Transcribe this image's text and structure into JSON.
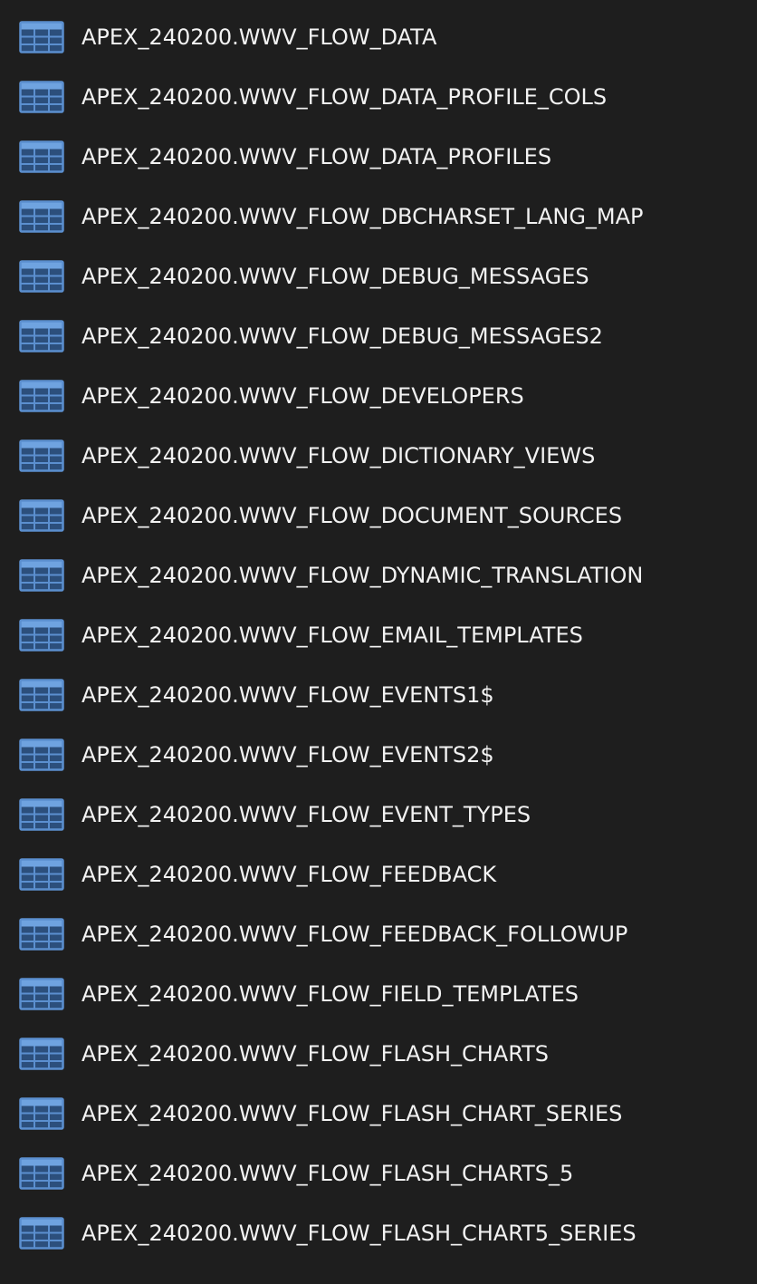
{
  "colors": {
    "background": "#1e1e1e",
    "text": "#f2f2f2",
    "icon_fill": "#2c4f7c",
    "icon_stroke": "#5b8fcf",
    "icon_header": "#6fa3e0"
  },
  "items": [
    {
      "label": "APEX_240200.WWV_FLOW_DATA",
      "icon": "table-icon"
    },
    {
      "label": "APEX_240200.WWV_FLOW_DATA_PROFILE_COLS",
      "icon": "table-icon"
    },
    {
      "label": "APEX_240200.WWV_FLOW_DATA_PROFILES",
      "icon": "table-icon"
    },
    {
      "label": "APEX_240200.WWV_FLOW_DBCHARSET_LANG_MAP",
      "icon": "table-icon"
    },
    {
      "label": "APEX_240200.WWV_FLOW_DEBUG_MESSAGES",
      "icon": "table-icon"
    },
    {
      "label": "APEX_240200.WWV_FLOW_DEBUG_MESSAGES2",
      "icon": "table-icon"
    },
    {
      "label": "APEX_240200.WWV_FLOW_DEVELOPERS",
      "icon": "table-icon"
    },
    {
      "label": "APEX_240200.WWV_FLOW_DICTIONARY_VIEWS",
      "icon": "table-icon"
    },
    {
      "label": "APEX_240200.WWV_FLOW_DOCUMENT_SOURCES",
      "icon": "table-icon"
    },
    {
      "label": "APEX_240200.WWV_FLOW_DYNAMIC_TRANSLATION",
      "icon": "table-icon"
    },
    {
      "label": "APEX_240200.WWV_FLOW_EMAIL_TEMPLATES",
      "icon": "table-icon"
    },
    {
      "label": "APEX_240200.WWV_FLOW_EVENTS1$",
      "icon": "table-icon"
    },
    {
      "label": "APEX_240200.WWV_FLOW_EVENTS2$",
      "icon": "table-icon"
    },
    {
      "label": "APEX_240200.WWV_FLOW_EVENT_TYPES",
      "icon": "table-icon"
    },
    {
      "label": "APEX_240200.WWV_FLOW_FEEDBACK",
      "icon": "table-icon"
    },
    {
      "label": "APEX_240200.WWV_FLOW_FEEDBACK_FOLLOWUP",
      "icon": "table-icon"
    },
    {
      "label": "APEX_240200.WWV_FLOW_FIELD_TEMPLATES",
      "icon": "table-icon"
    },
    {
      "label": "APEX_240200.WWV_FLOW_FLASH_CHARTS",
      "icon": "table-icon"
    },
    {
      "label": "APEX_240200.WWV_FLOW_FLASH_CHART_SERIES",
      "icon": "table-icon"
    },
    {
      "label": "APEX_240200.WWV_FLOW_FLASH_CHARTS_5",
      "icon": "table-icon"
    },
    {
      "label": "APEX_240200.WWV_FLOW_FLASH_CHART5_SERIES",
      "icon": "table-icon"
    }
  ]
}
